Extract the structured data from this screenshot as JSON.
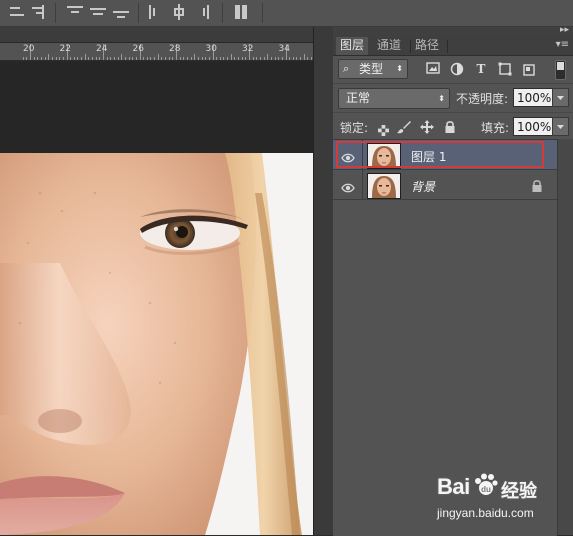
{
  "ruler": {
    "ticks": [
      "20",
      "22",
      "24",
      "26",
      "28",
      "30",
      "32",
      "34"
    ]
  },
  "panel": {
    "tabs": [
      {
        "label": "图层",
        "active": true
      },
      {
        "label": "通道",
        "active": false
      },
      {
        "label": "路径",
        "active": false
      }
    ],
    "filter": {
      "kind_label": "类型",
      "icons": [
        "image-filter-icon",
        "adjustment-filter-icon",
        "type-filter-icon",
        "shape-filter-icon",
        "smart-object-filter-icon"
      ]
    },
    "blend_mode": "正常",
    "opacity": {
      "label": "不透明度:",
      "value": "100%"
    },
    "lock": {
      "label": "锁定:",
      "icons": [
        "lock-transparent-icon",
        "lock-paint-icon",
        "lock-position-icon",
        "lock-all-icon"
      ]
    },
    "fill": {
      "label": "填充:",
      "value": "100%"
    },
    "layers": [
      {
        "name": "图层 1",
        "selected": true,
        "italic": false,
        "locked": false
      },
      {
        "name": "背景",
        "selected": false,
        "italic": true,
        "locked": true
      }
    ]
  },
  "watermark": {
    "brand": "Bai",
    "brand2": "经验",
    "url": "jingyan.baidu.com"
  },
  "colors": {
    "highlight": "#d33a3a",
    "selected_row": "#586176",
    "panel": "#535353"
  }
}
